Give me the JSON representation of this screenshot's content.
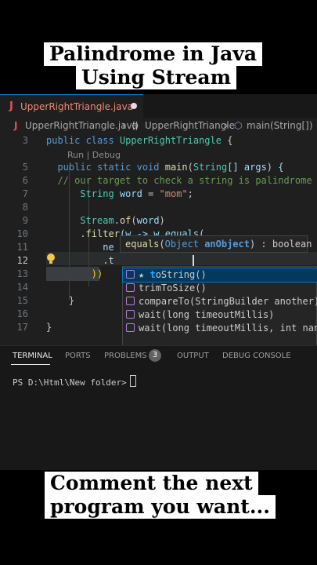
{
  "overlay": {
    "title_line1": "Palindrome in Java",
    "title_line2": "Using Stream",
    "bottom_line1": "Comment the next",
    "bottom_line2": "program you want..."
  },
  "editor": {
    "tab": {
      "icon": "J",
      "filename": "UpperRightTriangle.java",
      "modified": true
    },
    "breadcrumb": {
      "file": "UpperRightTriangle.java",
      "class": "UpperRightTriangle",
      "method": "main(String[])"
    },
    "codelens": "Run | Debug",
    "lines": {
      "l3": {
        "num": "3",
        "kw": "public class",
        "type": "UpperRightTriangle",
        "rest": " {"
      },
      "l5": {
        "num": "5"
      },
      "l6": {
        "num": "6",
        "comment": "// our target to check a string is palindrome"
      },
      "l7": {
        "num": "7",
        "type": "String",
        "var": "word",
        "str": "\"mom\""
      },
      "l8": {
        "num": "8"
      },
      "l9": {
        "num": "9",
        "type": "Stream",
        "fn": "of",
        "var": "word"
      },
      "l10": {
        "num": "10",
        "fn": "filter",
        "text": "(w -> w.equals("
      },
      "l11": {
        "num": "11",
        "text": "ne"
      },
      "l12": {
        "num": "12",
        "text": ".t"
      },
      "l13": {
        "num": "13",
        "text": "))"
      },
      "l14": {
        "num": "14"
      },
      "l15": {
        "num": "15",
        "text": "}"
      },
      "l16": {
        "num": "16"
      },
      "l17": {
        "num": "17",
        "text": "}"
      }
    },
    "main_line": {
      "kw1": "public static void",
      "fn": "main",
      "type": "String",
      "args": "[] args) {"
    },
    "signature_help": {
      "method": "equals",
      "param_type": "Object",
      "param_name": "anObject",
      "returns": ") : boolean"
    },
    "suggestions": [
      {
        "icon": "cube-icon",
        "star": "★ ",
        "hl": "t",
        "rest": "oString()",
        "active": true
      },
      {
        "icon": "cube-icon",
        "label": "trimToSize()"
      },
      {
        "icon": "cube-icon",
        "label": "compareTo(StringBuilder another)"
      },
      {
        "icon": "cube-icon",
        "label": "wait(long timeoutMillis)"
      },
      {
        "icon": "cube-icon",
        "label": "wait(long timeoutMillis, int nanos)"
      }
    ]
  },
  "panel": {
    "tabs": [
      "TERMINAL",
      "PORTS",
      "PROBLEMS",
      "OUTPUT",
      "DEBUG CONSOLE"
    ],
    "problems_count": "3",
    "prompt": "PS D:\\Html\\New folder>"
  },
  "colors": {
    "accent": "#0078d4",
    "error": "#f14c4c",
    "keyword": "#569cd6",
    "type": "#4ec9b0",
    "string": "#ce9178",
    "comment": "#6a9955"
  }
}
